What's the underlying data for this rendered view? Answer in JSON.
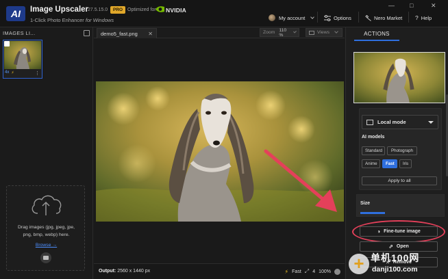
{
  "app": {
    "logo": "AI",
    "title": "Image Upscaler",
    "version": "27.5.15.0",
    "pro_badge": "PRO",
    "optimized_for": "Optimized for",
    "nvidia": "NVIDIA",
    "subtitle_main": "1-Click Photo Enhancer",
    "subtitle_for": "for Windows"
  },
  "titlebar": {
    "account": "My account",
    "options": "Options",
    "nero_market": "Nero Market",
    "help": "Help",
    "window_controls": [
      "—",
      "□",
      "✕"
    ]
  },
  "left_panel": {
    "header": "IMAGES LI...",
    "dropzone_text": "Drag images (jpg, jpeg, jpe, png, bmp, webp) here.",
    "browse": "Browse →"
  },
  "tab": {
    "filename": "demo5_fast.png",
    "close": "✕"
  },
  "toolbar": {
    "zoom_label": "Zoom",
    "zoom_value": "110 %",
    "views_label": "Views"
  },
  "status": {
    "output_label": "Output:",
    "output_value": "2560 x 1440 px",
    "mode": "Fast",
    "scale": "4",
    "percent": "100%"
  },
  "right_panel": {
    "tab": "ACTIONS",
    "mode": "Local mode",
    "ai_models_label": "AI models",
    "models": [
      "Standard",
      "Photograph",
      "Anime",
      "Fast",
      "Iris"
    ],
    "active_model": "Fast",
    "apply_all": "Apply to all",
    "size_label": "Size",
    "fine_tune": "Fine-tune image",
    "open": "Open",
    "remove": "Remove"
  },
  "watermark": {
    "cn": "单机100网",
    "url": "danji100.com"
  },
  "colors": {
    "accent": "#2f6fde",
    "highlight": "#e4405a",
    "pro": "#e0a72a",
    "nvidia": "#76b900"
  },
  "icons": [
    "ai-logo-icon",
    "nvidia-logo-icon",
    "avatar-icon",
    "options-icon",
    "market-icon",
    "help-icon",
    "cloud-upload-icon",
    "folder-icon",
    "close-icon",
    "views-icon",
    "bolt-icon",
    "expand-icon",
    "monitor-icon",
    "fine-tune-icon",
    "open-icon",
    "remove-icon"
  ]
}
